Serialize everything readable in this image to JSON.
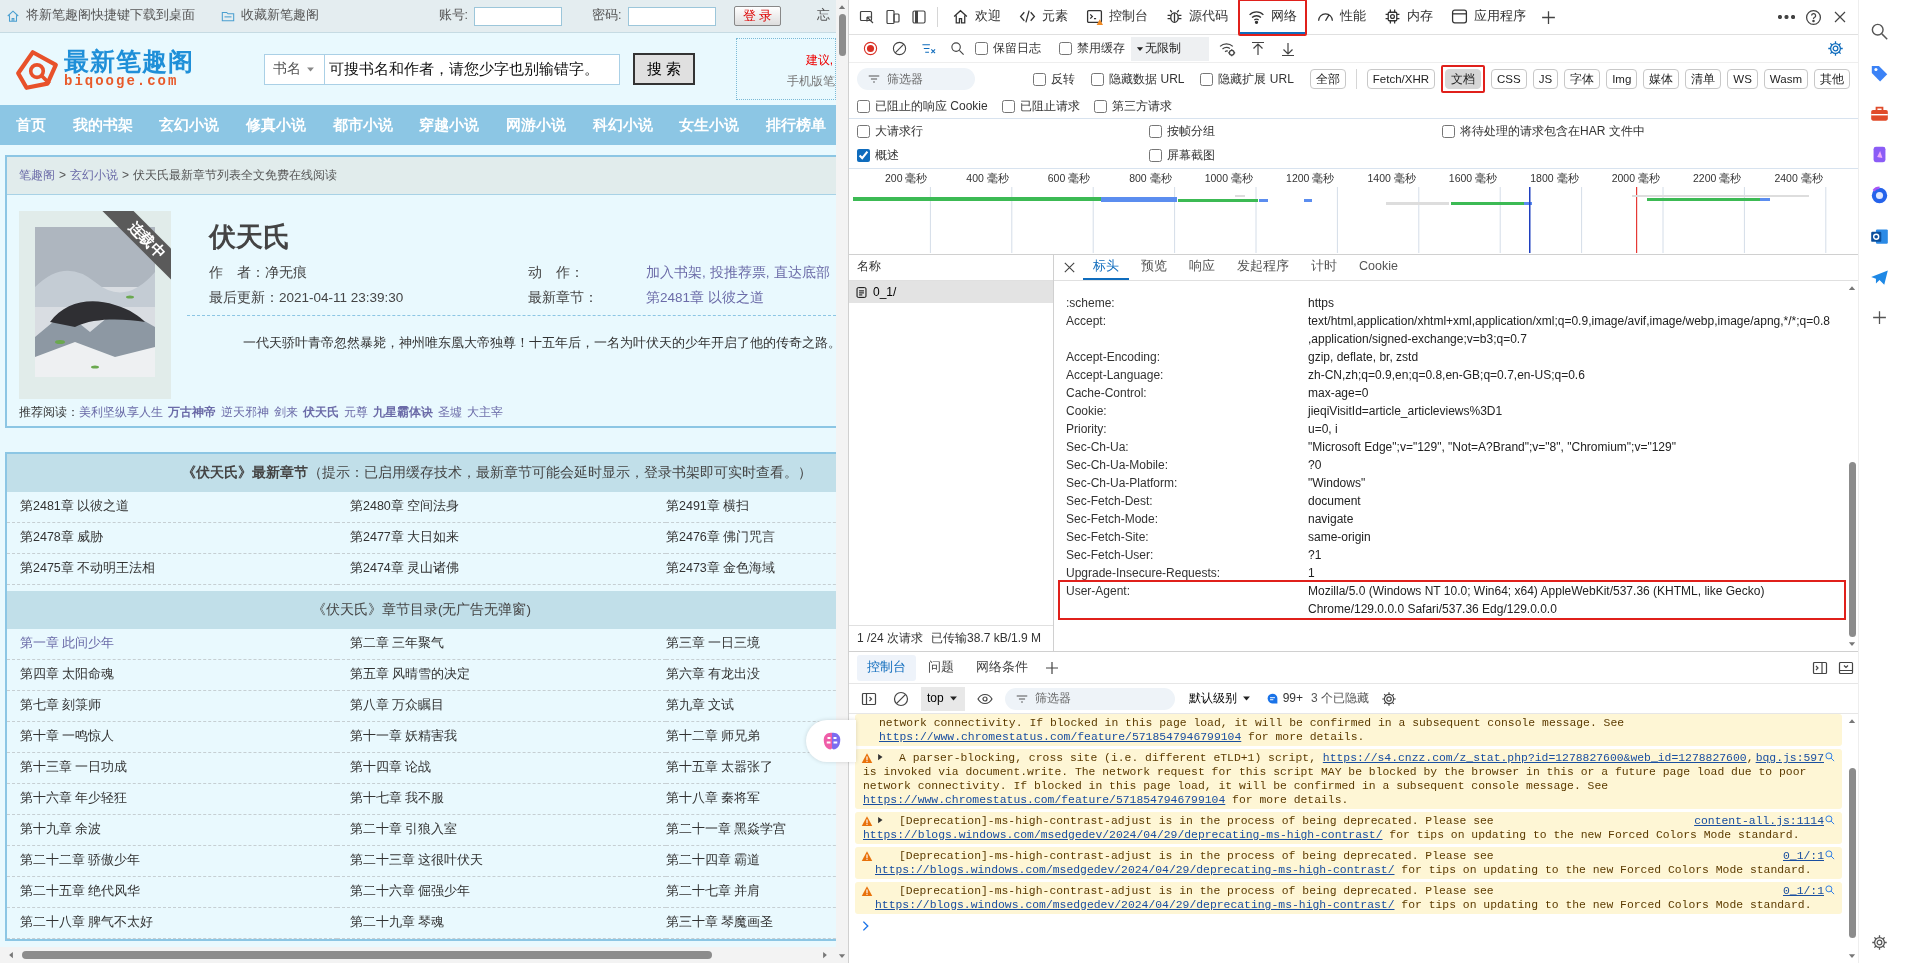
{
  "site": {
    "topbar": {
      "shortcut": "将新笔趣阁快捷键下载到桌面",
      "bookmark": "收藏新笔趣阁",
      "account_label": "账号:",
      "password_label": "密码:",
      "login": "登 录",
      "cut_link": "忘"
    },
    "logo": {
      "title": "最新笔趣阁",
      "domain": "biqooge.com"
    },
    "search": {
      "category": "书名",
      "value": "可搜书名和作者，请您少字也别输错字。",
      "button": "搜 索"
    },
    "side_box": {
      "suggest": "建议,",
      "mobile": "手机版笔"
    },
    "nav": [
      "首页",
      "我的书架",
      "玄幻小说",
      "修真小说",
      "都市小说",
      "穿越小说",
      "网游小说",
      "科幻小说",
      "女生小说",
      "排行榜单"
    ],
    "breadcrumb": [
      {
        "kind": "link",
        "text": "笔趣阁"
      },
      {
        "kind": "separator",
        "text": ">"
      },
      {
        "kind": "link",
        "text": "玄幻小说"
      },
      {
        "kind": "separator",
        "text": ">"
      },
      {
        "kind": "current",
        "text": "伏天氏最新章节列表全文免费在线阅读"
      }
    ],
    "book": {
      "ribbon": "连载中",
      "title": "伏天氏",
      "author_label": "作　者：",
      "author": "净无痕",
      "actions_label": "动　作：",
      "actions": [
        "加入书架,",
        "投推荐票,",
        "直达底部"
      ],
      "updated_label": "最后更新：",
      "updated": "2021-04-11 23:39:30",
      "latest_label": "最新章节：",
      "latest": "第2481章 以彼之道",
      "intro": "一代天骄叶青帝忽然暴毙，神州唯东凰大帝独尊！十五年后，一名为叶伏天的少年开启了他的传奇之路。"
    },
    "recommend": {
      "label": "推荐阅读：",
      "items": [
        {
          "text": "美利坚纵享人生",
          "bold": false
        },
        {
          "text": "万古神帝",
          "bold": true
        },
        {
          "text": "逆天邪神",
          "bold": false
        },
        {
          "text": "剑来",
          "bold": false
        },
        {
          "text": "伏天氏",
          "bold": true
        },
        {
          "text": "元尊",
          "bold": false
        },
        {
          "text": "九星霸体诀",
          "bold": true
        },
        {
          "text": "圣墟",
          "bold": false
        },
        {
          "text": "大主宰",
          "bold": false
        }
      ]
    },
    "latest": {
      "title": "《伏天氏》最新章节",
      "note": "（提示：已启用缓存技术，最新章节可能会延时显示，登录书架即可实时查看。）",
      "chapters": [
        {
          "text": "第2481章 以彼之道",
          "visited": false
        },
        {
          "text": "第2480章 空间法身",
          "visited": false
        },
        {
          "text": "第2491章 横扫",
          "visited": false
        },
        {
          "text": "第2478章 威胁",
          "visited": false
        },
        {
          "text": "第2477章 大日如来",
          "visited": false
        },
        {
          "text": "第2476章 佛门咒言",
          "visited": false
        },
        {
          "text": "第2475章 不动明王法相",
          "visited": false
        },
        {
          "text": "第2474章 灵山诸佛",
          "visited": false
        },
        {
          "text": "第2473章 金色海域",
          "visited": false
        }
      ]
    },
    "catalog": {
      "title": "《伏天氏》章节目录(无广告无弹窗)",
      "chapters": [
        {
          "text": "第一章 此间少年",
          "visited": true
        },
        {
          "text": "第二章 三年聚气",
          "visited": false
        },
        {
          "text": "第三章 一日三境",
          "visited": false
        },
        {
          "text": "第四章 太阳命魂",
          "visited": false
        },
        {
          "text": "第五章 风晴雪的决定",
          "visited": false
        },
        {
          "text": "第六章 有龙出没",
          "visited": false
        },
        {
          "text": "第七章 刻箓师",
          "visited": false
        },
        {
          "text": "第八章 万众瞩目",
          "visited": false
        },
        {
          "text": "第九章 文试",
          "visited": false
        },
        {
          "text": "第十章 一鸣惊人",
          "visited": false
        },
        {
          "text": "第十一章 妖精害我",
          "visited": false
        },
        {
          "text": "第十二章 师兄弟",
          "visited": false
        },
        {
          "text": "第十三章 一日功成",
          "visited": false
        },
        {
          "text": "第十四章 论战",
          "visited": false
        },
        {
          "text": "第十五章 太嚣张了",
          "visited": false
        },
        {
          "text": "第十六章 年少轻狂",
          "visited": false
        },
        {
          "text": "第十七章 我不服",
          "visited": false
        },
        {
          "text": "第十八章 秦将军",
          "visited": false
        },
        {
          "text": "第十九章 余波",
          "visited": false
        },
        {
          "text": "第二十章 引狼入室",
          "visited": false
        },
        {
          "text": "第二十一章 黑焱学宫",
          "visited": false
        },
        {
          "text": "第二十二章 骄傲少年",
          "visited": false
        },
        {
          "text": "第二十三章 这很叶伏天",
          "visited": false
        },
        {
          "text": "第二十四章 霸道",
          "visited": false
        },
        {
          "text": "第二十五章 绝代风华",
          "visited": false
        },
        {
          "text": "第二十六章 倔强少年",
          "visited": false
        },
        {
          "text": "第二十七章 并肩",
          "visited": false
        },
        {
          "text": "第二十八章 脾气不太好",
          "visited": false
        },
        {
          "text": "第二十九章 琴魂",
          "visited": false
        },
        {
          "text": "第三十章 琴魔画圣",
          "visited": false
        }
      ]
    }
  },
  "devtools": {
    "tabs": [
      {
        "label": "欢迎",
        "selected": false,
        "annotated": false
      },
      {
        "label": "元素",
        "selected": false,
        "annotated": false
      },
      {
        "label": "控制台",
        "selected": false,
        "annotated": false
      },
      {
        "label": "源代码",
        "selected": false,
        "annotated": false
      },
      {
        "label": "网络",
        "selected": true,
        "annotated": true
      },
      {
        "label": "性能",
        "selected": false,
        "annotated": false
      },
      {
        "label": "内存",
        "selected": false,
        "annotated": false
      },
      {
        "label": "应用程序",
        "selected": false,
        "annotated": false
      }
    ],
    "toolbar": {
      "preserve_log": {
        "label": "保留日志",
        "checked": false
      },
      "disable_cache": {
        "label": "禁用缓存",
        "checked": false
      },
      "throttle": "无限制"
    },
    "filter": {
      "placeholder": "筛选器",
      "options": [
        {
          "label": "反转",
          "checked": false
        },
        {
          "label": "隐藏数据 URL",
          "checked": false
        },
        {
          "label": "隐藏扩展 URL",
          "checked": false
        }
      ],
      "types": [
        {
          "label": "全部",
          "selected": false,
          "annotated": false
        },
        {
          "label": "Fetch/XHR",
          "selected": false,
          "annotated": false
        },
        {
          "label": "文档",
          "selected": true,
          "annotated": true
        },
        {
          "label": "CSS",
          "selected": false,
          "annotated": false
        },
        {
          "label": "JS",
          "selected": false,
          "annotated": false
        },
        {
          "label": "字体",
          "selected": false,
          "annotated": false
        },
        {
          "label": "Img",
          "selected": false,
          "annotated": false
        },
        {
          "label": "媒体",
          "selected": false,
          "annotated": false
        },
        {
          "label": "清单",
          "selected": false,
          "annotated": false
        },
        {
          "label": "WS",
          "selected": false,
          "annotated": false
        },
        {
          "label": "Wasm",
          "selected": false,
          "annotated": false
        },
        {
          "label": "其他",
          "selected": false,
          "annotated": false
        }
      ]
    },
    "blocked_options": [
      {
        "label": "已阻止的响应 Cookie",
        "checked": false
      },
      {
        "label": "已阻止请求",
        "checked": false
      },
      {
        "label": "第三方请求",
        "checked": false
      }
    ],
    "settings": [
      {
        "label": "大请求行",
        "checked": false
      },
      {
        "label": "按帧分组",
        "checked": false
      },
      {
        "label": "将待处理的请求包含在HAR 文件中",
        "checked": false
      },
      {
        "label": "概述",
        "checked": true
      },
      {
        "label": "屏幕截图",
        "checked": false
      }
    ],
    "timeline_ticks": [
      "200 毫秒",
      "400 毫秒",
      "600 毫秒",
      "800 毫秒",
      "1000 毫秒",
      "1200 毫秒",
      "1400 毫秒",
      "1600 毫秒",
      "1800 毫秒",
      "2000 毫秒",
      "2200 毫秒",
      "2400 毫秒"
    ],
    "requests": {
      "column": "名称",
      "rows": [
        {
          "name": "0_1/",
          "selected": true
        }
      ],
      "count": "1 /24 次请求",
      "transferred": "已传输38.7 kB/1.9 M"
    },
    "detail_tabs": [
      {
        "label": "标头",
        "selected": true
      },
      {
        "label": "预览",
        "selected": false
      },
      {
        "label": "响应",
        "selected": false
      },
      {
        "label": "发起程序",
        "selected": false
      },
      {
        "label": "计时",
        "selected": false
      },
      {
        "label": "Cookie",
        "selected": false
      }
    ],
    "headers": [
      {
        "name": ":scheme:",
        "lines": [
          "https"
        ],
        "annotated": false
      },
      {
        "name": "Accept:",
        "lines": [
          "text/html,application/xhtml+xml,application/xml;q=0.9,image/avif,image/webp,image/apng,*/*;q=0.8",
          ",application/signed-exchange;v=b3;q=0.7"
        ],
        "annotated": false
      },
      {
        "name": "Accept-Encoding:",
        "lines": [
          "gzip, deflate, br, zstd"
        ],
        "annotated": false
      },
      {
        "name": "Accept-Language:",
        "lines": [
          "zh-CN,zh;q=0.9,en;q=0.8,en-GB;q=0.7,en-US;q=0.6"
        ],
        "annotated": false
      },
      {
        "name": "Cache-Control:",
        "lines": [
          "max-age=0"
        ],
        "annotated": false
      },
      {
        "name": "Cookie:",
        "lines": [
          "jieqiVisitId=article_articleviews%3D1"
        ],
        "annotated": false
      },
      {
        "name": "Priority:",
        "lines": [
          "u=0, i"
        ],
        "annotated": false
      },
      {
        "name": "Sec-Ch-Ua:",
        "lines": [
          "\"Microsoft Edge\";v=\"129\", \"Not=A?Brand\";v=\"8\", \"Chromium\";v=\"129\""
        ],
        "annotated": false
      },
      {
        "name": "Sec-Ch-Ua-Mobile:",
        "lines": [
          "?0"
        ],
        "annotated": false
      },
      {
        "name": "Sec-Ch-Ua-Platform:",
        "lines": [
          "\"Windows\""
        ],
        "annotated": false
      },
      {
        "name": "Sec-Fetch-Dest:",
        "lines": [
          "document"
        ],
        "annotated": false
      },
      {
        "name": "Sec-Fetch-Mode:",
        "lines": [
          "navigate"
        ],
        "annotated": false
      },
      {
        "name": "Sec-Fetch-Site:",
        "lines": [
          "same-origin"
        ],
        "annotated": false
      },
      {
        "name": "Sec-Fetch-User:",
        "lines": [
          "?1"
        ],
        "annotated": false
      },
      {
        "name": "Upgrade-Insecure-Requests:",
        "lines": [
          "1"
        ],
        "annotated": false
      },
      {
        "name": "User-Agent:",
        "lines": [
          "Mozilla/5.0 (Windows NT 10.0; Win64; x64) AppleWebKit/537.36 (KHTML, like Gecko)",
          "Chrome/129.0.0.0 Safari/537.36 Edg/129.0.0.0"
        ],
        "annotated": true
      }
    ],
    "console": {
      "tabs": [
        {
          "label": "控制台",
          "selected": true
        },
        {
          "label": "问题",
          "selected": false
        },
        {
          "label": "网络条件",
          "selected": false
        }
      ],
      "context": "top",
      "filter_placeholder": "筛选器",
      "level": "默认级别",
      "message_count": "99+",
      "hidden": "3 个已隐藏",
      "messages": [
        {
          "warning": false,
          "expandable": false,
          "lines": [
            [
              {
                "text": "network connectivity. If blocked in this page load, it will be confirmed in a subsequent console message. See",
                "link": false
              }
            ],
            [
              {
                "text": "https://www.chromestatus.com/feature/5718547946799104",
                "link": true
              },
              {
                "text": " for more details.",
                "link": false
              }
            ]
          ]
        },
        {
          "warning": true,
          "expandable": true,
          "source": "bqg.js:597",
          "lines": [
            [
              {
                "text": "A parser-blocking, cross site (i.e. different eTLD+1) script, ",
                "link": false
              },
              {
                "text": "https://s4.cnzz.com/z_stat.php?id=1278827600&web_id=1278827600",
                "link": true
              },
              {
                "text": ",",
                "link": false
              }
            ],
            [
              {
                "text": "is invoked via document.write. The network request for this script MAY be blocked by the browser in this or a future page load due to poor",
                "link": false
              }
            ],
            [
              {
                "text": "network connectivity. If blocked in this page load, it will be confirmed in a subsequent console message. See",
                "link": false
              }
            ],
            [
              {
                "text": "https://www.chromestatus.com/feature/5718547946799104",
                "link": true
              },
              {
                "text": " for more details.",
                "link": false
              }
            ]
          ]
        },
        {
          "warning": true,
          "expandable": true,
          "source": "content-all.js:1114",
          "lines": [
            [
              {
                "text": "[Deprecation]-ms-high-contrast-adjust is in the process of being deprecated. Please see",
                "link": false
              }
            ],
            [
              {
                "text": "https://blogs.windows.com/msedgedev/2024/04/29/deprecating-ms-high-contrast/",
                "link": true
              },
              {
                "text": " for tips on updating to the new Forced Colors Mode standard.",
                "link": false
              }
            ]
          ]
        },
        {
          "warning": true,
          "expandable": false,
          "source": "0_1/:1",
          "lines": [
            [
              {
                "text": "[Deprecation]-ms-high-contrast-adjust is in the process of being deprecated. Please see",
                "link": false
              }
            ],
            [
              {
                "text": "https://blogs.windows.com/msedgedev/2024/04/29/deprecating-ms-high-contrast/",
                "link": true
              },
              {
                "text": " for tips on updating to the new Forced Colors Mode standard.",
                "link": false
              }
            ]
          ]
        },
        {
          "warning": true,
          "expandable": false,
          "source": "0_1/:1",
          "lines": [
            [
              {
                "text": "[Deprecation]-ms-high-contrast-adjust is in the process of being deprecated. Please see",
                "link": false
              }
            ],
            [
              {
                "text": "https://blogs.windows.com/msedgedev/2024/04/29/deprecating-ms-high-contrast/",
                "link": true
              },
              {
                "text": " for tips on updating to the new Forced Colors Mode standard.",
                "link": false
              }
            ]
          ]
        }
      ]
    }
  }
}
